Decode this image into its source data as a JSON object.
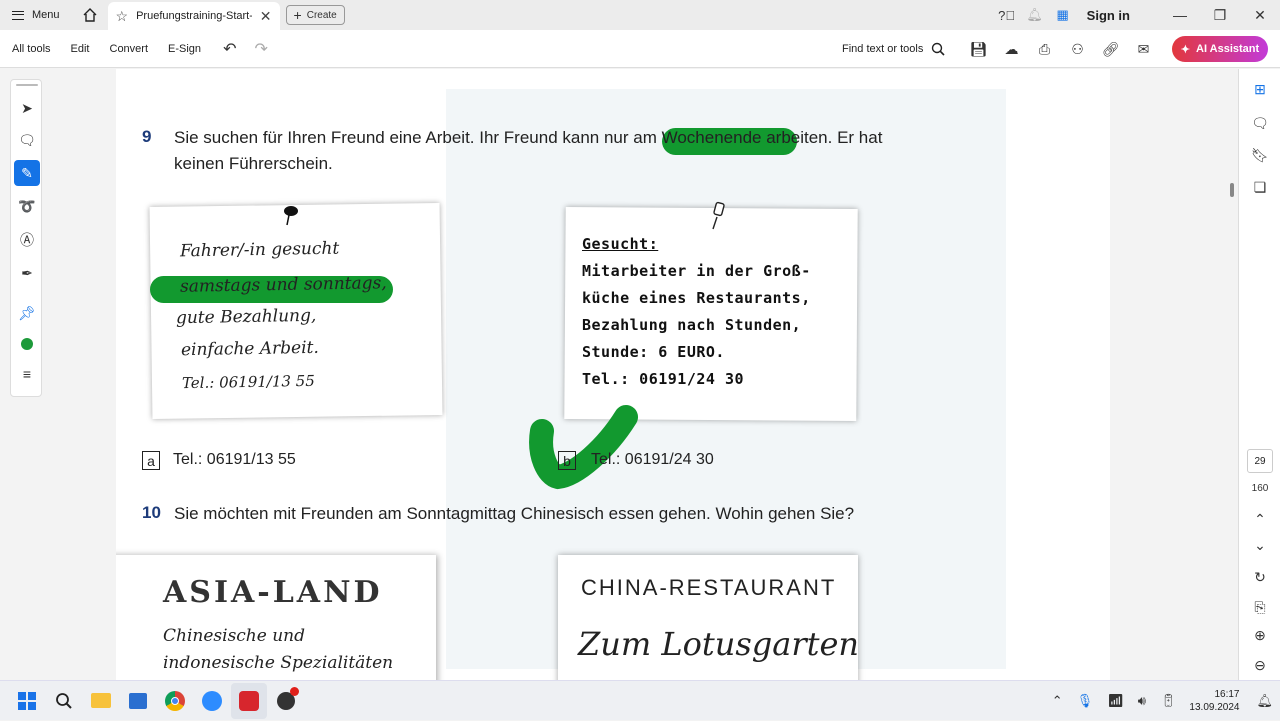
{
  "titlebar": {
    "menu_label": "Menu",
    "tab_title": "Pruefungstraining-Start-...",
    "create_label": "Create",
    "sign_in": "Sign in"
  },
  "toolbar": {
    "items": [
      "All tools",
      "Edit",
      "Convert",
      "E-Sign"
    ],
    "find_label": "Find text or tools",
    "ai_label": "AI Assistant"
  },
  "document": {
    "q9": {
      "number": "9",
      "line1": "Sie suchen für Ihren Freund eine Arbeit. Ihr Freund kann nur am Wochenende arbeiten. Er hat",
      "line2": "keinen Führerschein.",
      "card_a": [
        "Fahrer/-in gesucht",
        "samstags und sonntags,",
        "gute Bezahlung,",
        "einfache Arbeit.",
        "Tel.: 06191/13 55"
      ],
      "card_b": [
        "Gesucht:",
        "Mitarbeiter in der Groß-",
        "küche eines Restaurants,",
        "Bezahlung nach Stunden,",
        "Stunde: 6 EURO.",
        "Tel.: 06191/24 30"
      ],
      "option_a_box": "a",
      "option_a": "Tel.: 06191/13 55",
      "option_b_box": "b",
      "option_b": "Tel.: 06191/24 30"
    },
    "q10": {
      "number": "10",
      "text": "Sie möchten mit Freunden am Sonntagmittag Chinesisch essen gehen. Wohin gehen Sie?",
      "card_a_title": "ASIA-LAND",
      "card_a_sub1": "Chinesische und",
      "card_a_sub2": "indonesische Spezialitäten",
      "card_b_title": "CHINA-RESTAURANT",
      "card_b_sub": "Zum Lotusgarten"
    }
  },
  "page_nav": {
    "current": "29",
    "total": "160"
  },
  "taskbar": {
    "time": "16:17",
    "date": "13.09.2024"
  },
  "colors": {
    "highlight": "#12992f",
    "accent": "#1473e6"
  }
}
